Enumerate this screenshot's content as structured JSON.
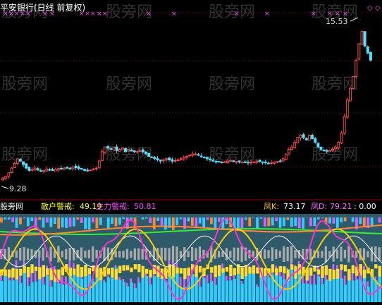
{
  "header": {
    "title": "平安银行(日线 前复权)",
    "color": "#ffffff"
  },
  "indicator_bar": {
    "name": "股旁网",
    "label1": "散户警戒:",
    "value1": "49.19",
    "label2": "主力警戒:",
    "value2": "50.81",
    "label3": "凤K:",
    "value3": "73.17",
    "label4": "凤D:",
    "value4": "79.21",
    "value5": ": 0.00",
    "colors": {
      "name": "#ffffff",
      "label1": "#ffff00",
      "value1": "#ffff00",
      "label2": "#ff44ff",
      "value2": "#ff44ff",
      "label3": "#ffcc00",
      "value3": "#ffffff",
      "label4": "#ff66ff",
      "value4": "#ff66ff",
      "value5": "#ffffff"
    }
  },
  "markers": {
    "x_glyph": "×",
    "diamond_glyph": "◇",
    "color": "#ff44ff"
  },
  "price_annotations": {
    "high": "15.53",
    "low": "9.28"
  },
  "watermark": "股旁网",
  "chart_data": [
    {
      "type": "candlestick",
      "title": "平安银行(日线 前复权)",
      "up_color": "#ff4a4a",
      "down_color": "#4fe3ff",
      "ylim": [
        8.5,
        16.2
      ],
      "annotated_high": 15.53,
      "annotated_low": 9.28,
      "close": [
        9.28,
        9.35,
        9.5,
        9.7,
        9.9,
        10.1,
        10.0,
        9.85,
        9.7,
        9.6,
        9.65,
        9.7,
        9.62,
        9.58,
        9.6,
        9.66,
        9.62,
        9.6,
        9.65,
        9.68,
        9.66,
        9.7,
        9.72,
        9.7,
        9.75,
        9.72,
        9.68,
        9.66,
        9.6,
        9.58,
        9.62,
        9.65,
        9.7,
        10.0,
        10.4,
        10.6,
        10.55,
        10.5,
        10.6,
        10.45,
        10.5,
        10.55,
        10.4,
        10.5,
        10.45,
        10.4,
        10.42,
        10.45,
        10.4,
        10.3,
        10.2,
        10.15,
        10.1,
        10.05,
        10.0,
        10.05,
        10.1,
        10.05,
        10.0,
        10.02,
        10.05,
        10.1,
        10.15,
        10.2,
        10.25,
        10.3,
        10.3,
        10.25,
        10.2,
        10.15,
        10.1,
        10.05,
        10.0,
        9.98,
        9.96,
        9.95,
        9.97,
        10.0,
        10.02,
        10.0,
        9.98,
        9.96,
        9.95,
        9.94,
        9.93,
        9.95,
        9.97,
        10.0,
        9.98,
        9.95,
        9.93,
        9.9,
        9.92,
        9.95,
        9.98,
        10.0,
        10.1,
        10.3,
        10.5,
        10.6,
        10.8,
        11.0,
        11.1,
        11.0,
        10.9,
        11.1,
        10.95,
        10.8,
        10.6,
        10.5,
        10.45,
        10.42,
        10.45,
        10.5,
        10.6,
        10.8,
        11.2,
        11.9,
        12.6,
        13.1,
        13.6,
        14.3,
        15.0,
        15.53,
        14.9,
        14.6,
        14.3
      ]
    },
    {
      "type": "oscillator",
      "title": "股旁网",
      "series": [
        {
          "name": "散户警戒",
          "value": 49.19
        },
        {
          "name": "主力警戒",
          "value": 50.81
        },
        {
          "name": "凤K",
          "value": 73.17
        },
        {
          "name": "凤D",
          "value": 79.21
        }
      ]
    }
  ]
}
